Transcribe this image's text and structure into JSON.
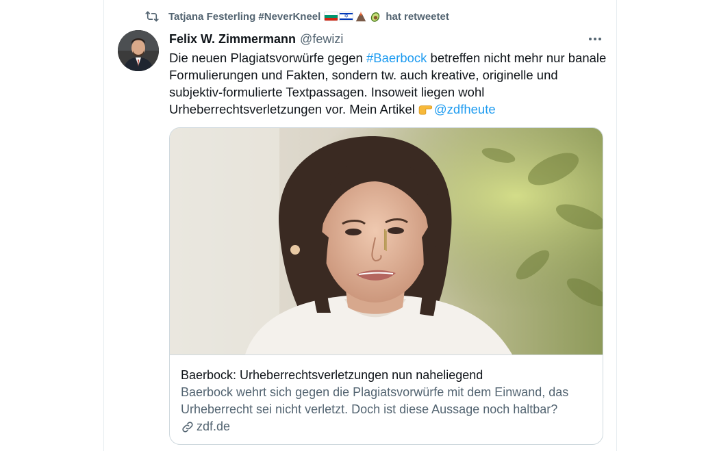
{
  "retweet": {
    "retweeter": "Tatjana Festerling #NeverKneel",
    "suffix": "hat retweetet",
    "icon": "retweet-icon",
    "emoji": [
      "bulgaria-flag",
      "israel-flag",
      "volcano",
      "avocado"
    ]
  },
  "tweet": {
    "author_name": "Felix W. Zimmermann",
    "author_handle": "@fewizi",
    "more_icon": "more-icon",
    "text_1": "Die neuen Plagiatsvorwürfe gegen ",
    "hashtag": "#Baerbock",
    "text_2": " betreffen nicht mehr nur banale Formulierungen und Fakten, sondern tw. auch kreative, originelle und subjektiv-formulierte Textpassagen. Insoweit liegen wohl Urheberrechtsverletzungen vor. Mein Artikel",
    "mention": "@zdfheute",
    "emoji_pointing": "backhand-index-pointing-right"
  },
  "card": {
    "title": "Baerbock: Urheberrechtsverletzungen nun naheliegend",
    "description": "Baerbock wehrt sich gegen die Plagiatsvorwürfe mit dem Einwand, das Urheberrecht sei nicht verletzt. Doch ist diese Aussage noch haltbar?",
    "domain": "zdf.de",
    "domain_icon": "link-icon"
  },
  "colors": {
    "link": "#1d9bf0",
    "secondary_text": "#536471",
    "primary_text": "#0f1419",
    "border": "#cfd9de"
  }
}
